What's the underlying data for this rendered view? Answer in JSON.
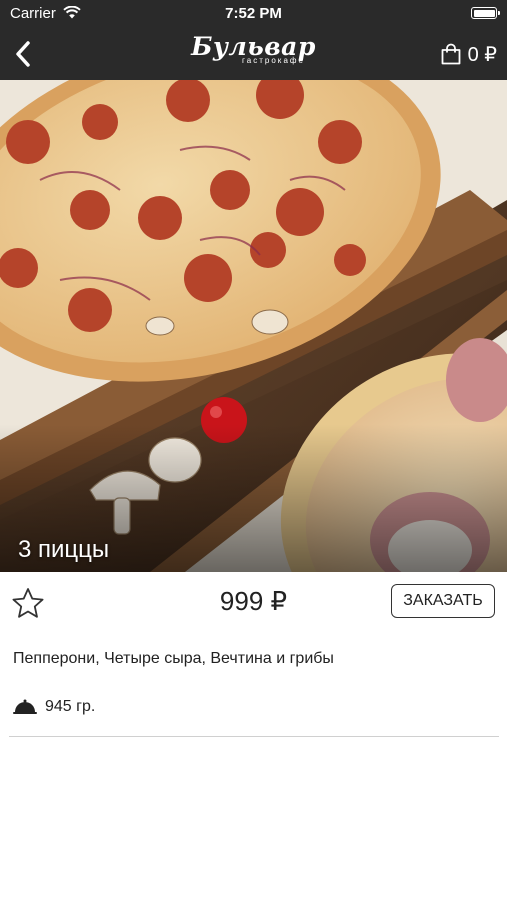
{
  "status_bar": {
    "carrier": "Carrier",
    "time": "7:52 PM"
  },
  "nav": {
    "logo_main": "Бульвар",
    "logo_sub": "гастрокафе",
    "cart_amount": "0 ₽"
  },
  "product": {
    "title": "3 пиццы",
    "price": "999 ₽",
    "order_label": "ЗАКАЗАТЬ",
    "description": "Пепперони, Четыре сыра, Вечтина и грибы",
    "weight": "945 гр."
  },
  "icons": {
    "back": "chevron-left-icon",
    "wifi": "wifi-icon",
    "battery": "battery-icon",
    "cart": "shopping-bag-icon",
    "favorite": "star-outline-icon",
    "weight": "dish-cloche-icon"
  },
  "colors": {
    "nav_background": "#2a2a2a",
    "background": "#ffffff",
    "text": "#222222",
    "divider": "#d0d0d0"
  }
}
